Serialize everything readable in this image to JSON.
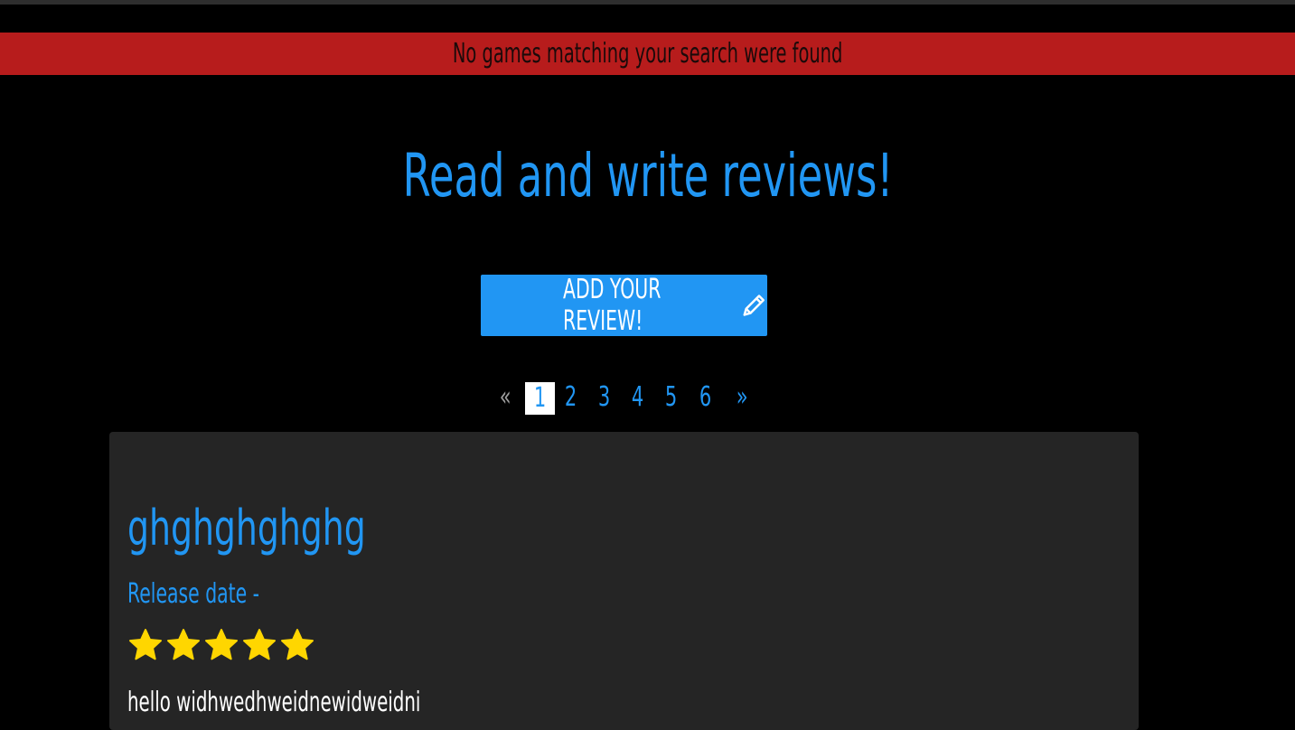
{
  "alert": {
    "message": "No games matching your search were found"
  },
  "headline": "Read and write reviews!",
  "add_review_button": {
    "label": "ADD YOUR REVIEW!",
    "icon": "pencil-icon"
  },
  "pagination": {
    "prev_label": "«",
    "next_label": "»",
    "pages": [
      "1",
      "2",
      "3",
      "4",
      "5",
      "6"
    ],
    "current_page": "1"
  },
  "review": {
    "title": "ghghghghghg",
    "release_date": "Release date -",
    "rating": 5,
    "rating_max": 5,
    "body": "hello widhwedhweidnewidweidni"
  },
  "colors": {
    "background": "#000000",
    "alert_bg": "#b71c1c",
    "accent": "#2196f3",
    "card_bg": "#252525",
    "star": "#ffd600"
  }
}
